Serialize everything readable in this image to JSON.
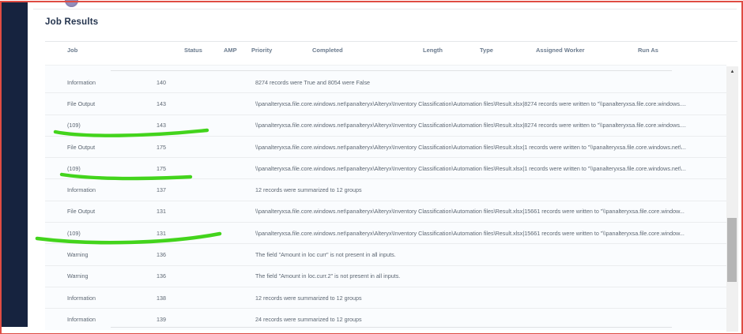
{
  "page": {
    "title": "Job Results"
  },
  "table": {
    "columns": [
      "Job",
      "Status",
      "AMP",
      "Priority",
      "Completed",
      "Length",
      "Type",
      "Assigned Worker",
      "Run As"
    ],
    "rows": [
      {
        "type": "Information",
        "id": "140",
        "message": "8274 records were True and 8054 were False",
        "marked": false
      },
      {
        "type": "File Output",
        "id": "143",
        "message": "\\\\panalteryxsa.file.core.windows.net\\panalteryx\\Alteryx\\Inventory Classification\\Automation files\\Result.xlsx|8274 records were written to \"\\\\panalteryxsa.file.core.windows....",
        "marked": false
      },
      {
        "type": "(109)",
        "id": "143",
        "message": "\\\\panalteryxsa.file.core.windows.net\\panalteryx\\Alteryx\\Inventory Classification\\Automation files\\Result.xlsx|8274 records were written to \"\\\\panalteryxsa.file.core.windows....",
        "marked": true
      },
      {
        "type": "File Output",
        "id": "175",
        "message": "\\\\panalteryxsa.file.core.windows.net\\panalteryx\\Alteryx\\Inventory Classification\\Automation files\\Result.xlsx|1 records were written to \"\\\\panalteryxsa.file.core.windows.net\\...",
        "marked": false
      },
      {
        "type": "(109)",
        "id": "175",
        "message": "\\\\panalteryxsa.file.core.windows.net\\panalteryx\\Alteryx\\Inventory Classification\\Automation files\\Result.xlsx|1 records were written to \"\\\\panalteryxsa.file.core.windows.net\\...",
        "marked": true
      },
      {
        "type": "Information",
        "id": "137",
        "message": "12 records were summarized to 12 groups",
        "marked": false
      },
      {
        "type": "File Output",
        "id": "131",
        "message": "\\\\panalteryxsa.file.core.windows.net\\panalteryx\\Alteryx\\Inventory Classification\\Automation files\\Result.xlsx|15661 records were written to \"\\\\panalteryxsa.file.core.window...",
        "marked": false
      },
      {
        "type": "(109)",
        "id": "131",
        "message": "\\\\panalteryxsa.file.core.windows.net\\panalteryx\\Alteryx\\Inventory Classification\\Automation files\\Result.xlsx|15661 records were written to \"\\\\panalteryxsa.file.core.window...",
        "marked": true
      },
      {
        "type": "Warning",
        "id": "136",
        "message": "The field \"Amount in loc curr\" is not present in all inputs.",
        "marked": false
      },
      {
        "type": "Warning",
        "id": "136",
        "message": "The field \"Amount in loc.curr.2\" is not present in all inputs.",
        "marked": false
      },
      {
        "type": "Information",
        "id": "138",
        "message": "12 records were summarized to 12 groups",
        "marked": false
      },
      {
        "type": "Information",
        "id": "139",
        "message": "24 records were summarized to 12 groups",
        "marked": false
      }
    ]
  },
  "scrollbar": {
    "up_arrow_glyph": "▲"
  },
  "colors": {
    "marker_green": "#43d41c",
    "frame_red": "#df4c43",
    "sidebar_navy": "#16233f",
    "circle_purple": "#938dbb"
  }
}
